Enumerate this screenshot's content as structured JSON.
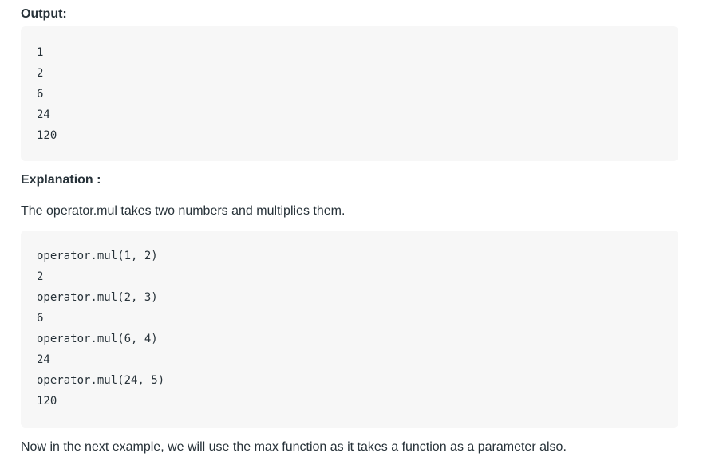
{
  "output": {
    "heading": "Output:",
    "lines": [
      "1",
      "2",
      "6",
      "24",
      "120"
    ]
  },
  "explanation": {
    "heading": "Explanation :",
    "intro": "The operator.mul takes two numbers and multiplies them.",
    "code_lines": [
      "operator.mul(1, 2)",
      "2",
      "operator.mul(2, 3)",
      "6",
      "operator.mul(6, 4)",
      "24",
      "operator.mul(24, 5)",
      "120"
    ],
    "outro": "Now in the next example, we will use the max function as it takes a function as a parameter also."
  },
  "colors": {
    "text": "#273239",
    "code_background": "#f7f7f7"
  }
}
